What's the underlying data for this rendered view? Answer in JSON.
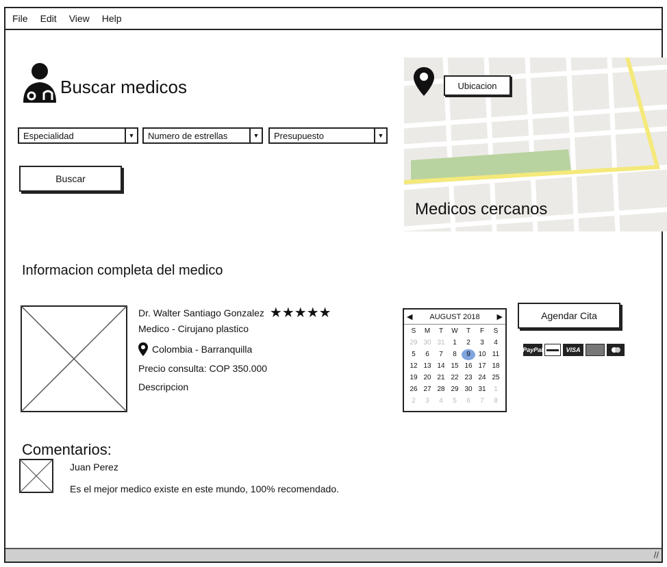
{
  "menu": [
    "File",
    "Edit",
    "View",
    "Help"
  ],
  "header": {
    "title": "Buscar medicos"
  },
  "filters": [
    {
      "label": "Especialidad"
    },
    {
      "label": "Numero de estrellas"
    },
    {
      "label": "Presupuesto"
    }
  ],
  "search_button": "Buscar",
  "map": {
    "location_button": "Ubicacion",
    "caption": "Medicos cercanos"
  },
  "section_title": "Informacion completa del medico",
  "doctor": {
    "name": "Dr. Walter Santiago Gonzalez",
    "rating": "★★★★★",
    "specialty": "Medico - Cirujano plastico",
    "location": "Colombia - Barranquilla",
    "price": "Precio consulta: COP 350.000",
    "description": "Descripcion"
  },
  "calendar": {
    "month": "AUGUST 2018",
    "weekdays": [
      "S",
      "M",
      "T",
      "W",
      "T",
      "F",
      "S"
    ],
    "days": [
      {
        "d": "29",
        "dim": true
      },
      {
        "d": "30",
        "dim": true
      },
      {
        "d": "31",
        "dim": true
      },
      {
        "d": "1"
      },
      {
        "d": "2"
      },
      {
        "d": "3"
      },
      {
        "d": "4"
      },
      {
        "d": "5"
      },
      {
        "d": "6"
      },
      {
        "d": "7"
      },
      {
        "d": "8"
      },
      {
        "d": "9",
        "sel": true
      },
      {
        "d": "10"
      },
      {
        "d": "11"
      },
      {
        "d": "12"
      },
      {
        "d": "13"
      },
      {
        "d": "14"
      },
      {
        "d": "15"
      },
      {
        "d": "16"
      },
      {
        "d": "17"
      },
      {
        "d": "18"
      },
      {
        "d": "19"
      },
      {
        "d": "20"
      },
      {
        "d": "21"
      },
      {
        "d": "22"
      },
      {
        "d": "23"
      },
      {
        "d": "24"
      },
      {
        "d": "25"
      },
      {
        "d": "26"
      },
      {
        "d": "27"
      },
      {
        "d": "28"
      },
      {
        "d": "29"
      },
      {
        "d": "30"
      },
      {
        "d": "31"
      },
      {
        "d": "1",
        "dim": true
      },
      {
        "d": "2",
        "dim": true
      },
      {
        "d": "3",
        "dim": true
      },
      {
        "d": "4",
        "dim": true
      },
      {
        "d": "5",
        "dim": true
      },
      {
        "d": "6",
        "dim": true
      },
      {
        "d": "7",
        "dim": true
      },
      {
        "d": "8",
        "dim": true
      }
    ]
  },
  "appointment_button": "Agendar Cita",
  "payment_cards": [
    "PayPal",
    "",
    "VISA",
    "",
    ""
  ],
  "comments": {
    "title": "Comentarios:",
    "items": [
      {
        "author": "Juan Perez",
        "text": "Es el mejor medico existe en este mundo, 100% recomendado."
      }
    ]
  }
}
